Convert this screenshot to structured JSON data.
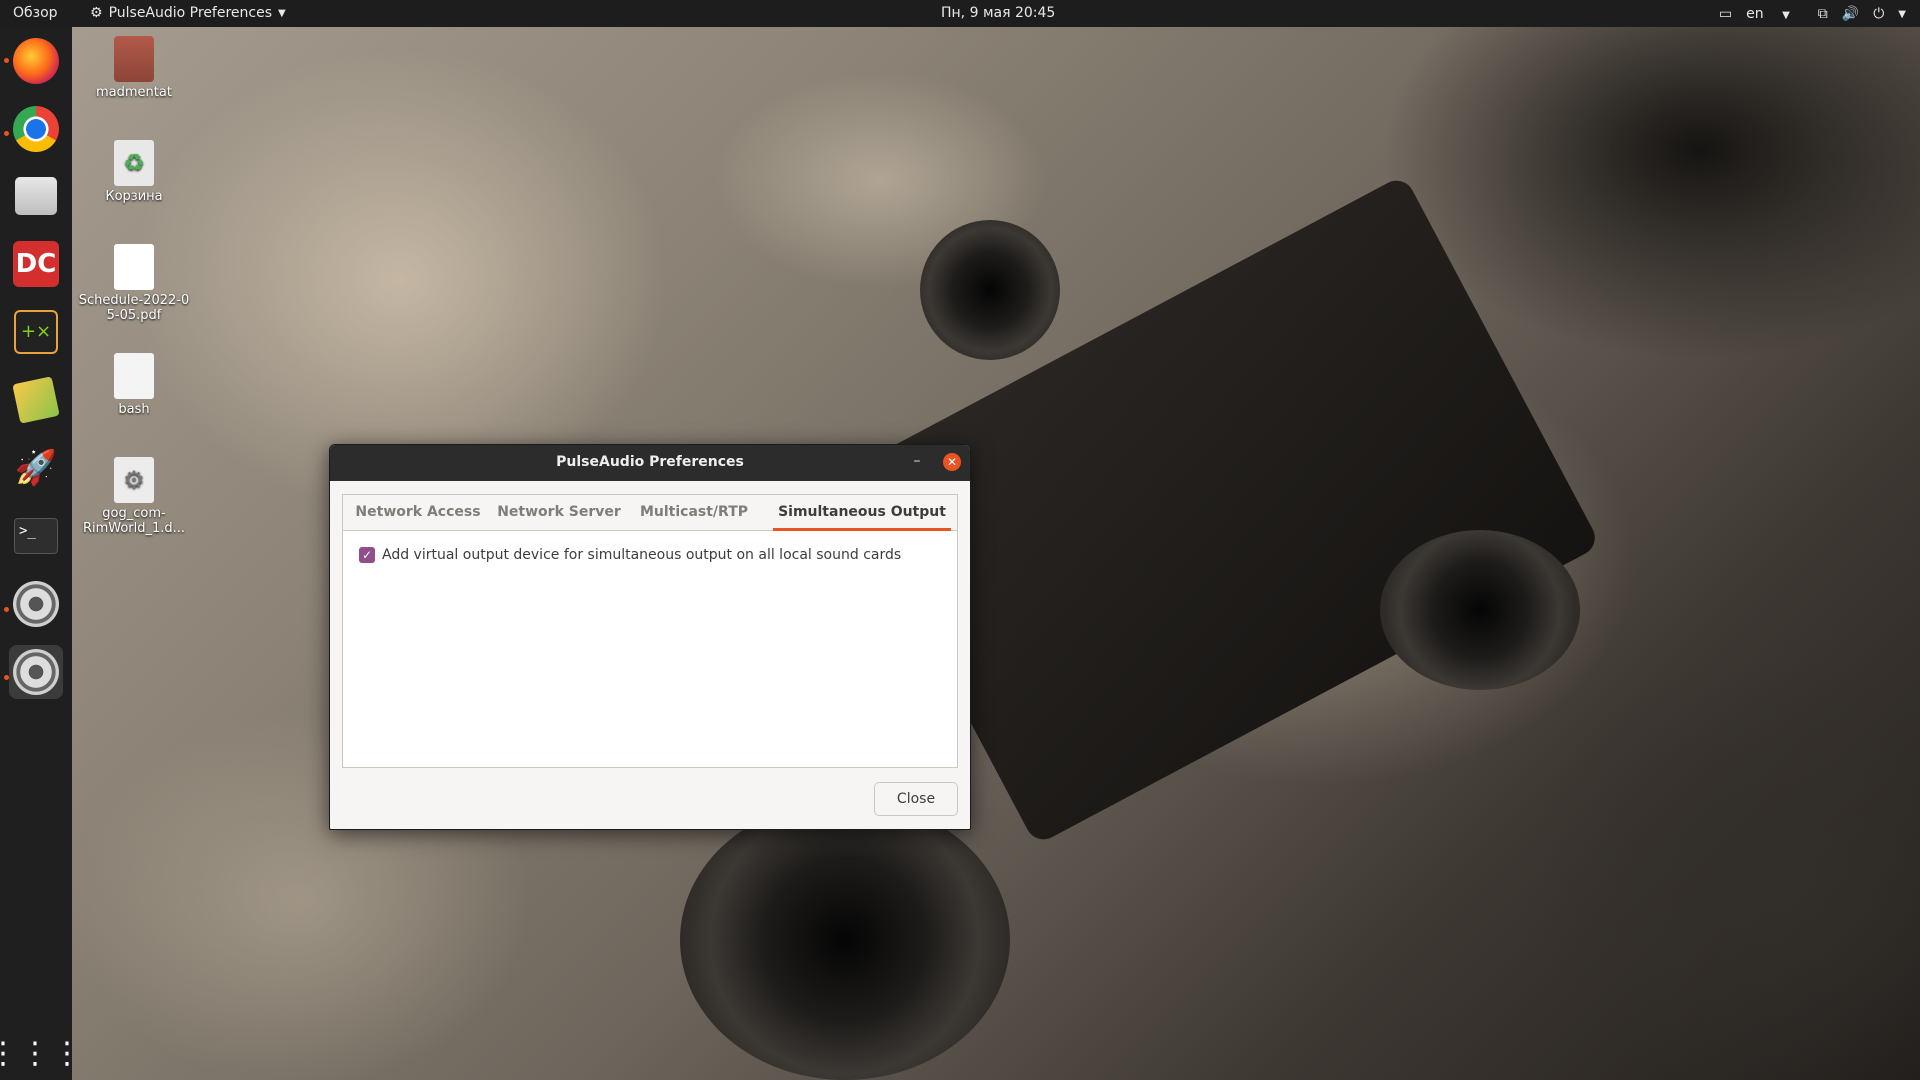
{
  "topbar": {
    "activities": "Обзор",
    "app_menu": "PulseAudio Preferences",
    "clock": "Пн, 9 мая  20:45",
    "keyboard_layout": "en"
  },
  "dock": {
    "items": [
      "firefox-icon",
      "chrome-icon",
      "files-icon",
      "app-dc-icon",
      "calculator-icon",
      "text-editor-icon",
      "rocket-launcher-icon",
      "terminal-icon",
      "settings-icon",
      "settings-icon"
    ],
    "accent_color": "#e95420"
  },
  "desktop": {
    "icons": [
      {
        "label": "madmentat"
      },
      {
        "label": "Корзина"
      },
      {
        "label": "Schedule-2022-05-05.pdf",
        "label_line1": "Schedule-2022-0",
        "label_line2": "5-05.pdf"
      },
      {
        "label": "bash"
      },
      {
        "label": "gog_com-RimWorld_1.d...",
        "label_line1": "gog_com-",
        "label_line2": "RimWorld_1.d..."
      }
    ]
  },
  "dialog": {
    "title": "PulseAudio Preferences",
    "tabs": [
      {
        "label": "Network Access"
      },
      {
        "label": "Network Server"
      },
      {
        "label": "Multicast/RTP"
      },
      {
        "label": "Simultaneous Output",
        "active": true
      }
    ],
    "checkbox": {
      "label": "Add virtual output device for simultaneous output on all local sound cards",
      "checked": true
    },
    "close_button": "Close",
    "accent_color": "#e95420",
    "checkbox_color": "#924d8b"
  }
}
